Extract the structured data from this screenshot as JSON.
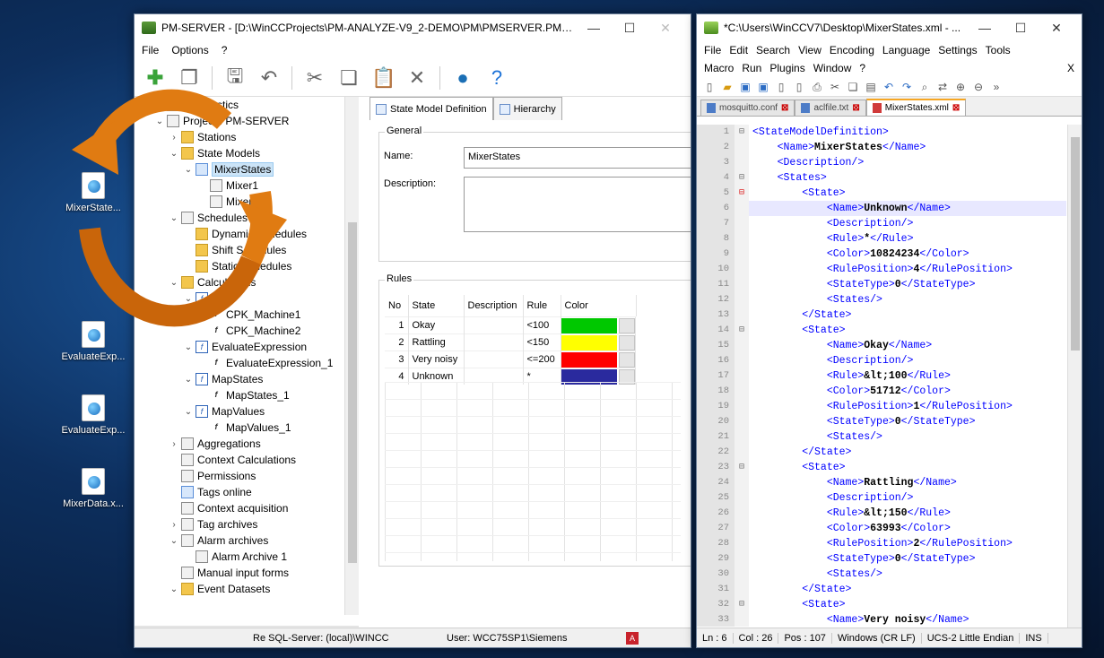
{
  "desktop": {
    "icons": [
      "MixerState...",
      "EvaluateExp...",
      "EvaluateExp...",
      "MixerData.x..."
    ]
  },
  "pm": {
    "title": "PM-SERVER - [D:\\WinCCProjects\\PM-ANALYZE-V9_2-DEMO\\PM\\PMSERVER.PMProj...",
    "minimize": "—",
    "maximize": "☐",
    "close": "✕",
    "menu": [
      "File",
      "Options",
      "?"
    ],
    "tree": [
      "Diagnostics",
      "Project : PM-SERVER",
      "Stations",
      "State Models",
      "MixerStates",
      "Mixer1",
      "Mixer2",
      "Schedules",
      "Dynamic Schedules",
      "Shift Schedules",
      "Static Schedules",
      "Calculations",
      "CPK",
      "CPK_Machine1",
      "CPK_Machine2",
      "EvaluateExpression",
      "EvaluateExpression_1",
      "MapStates",
      "MapStates_1",
      "MapValues",
      "MapValues_1",
      "Aggregations",
      "Context Calculations",
      "Permissions",
      "Tags online",
      "Context acquisition",
      "Tag archives",
      "Alarm archives",
      "Alarm Archive 1",
      "Manual input forms",
      "Event Datasets"
    ],
    "tabs": [
      "State Model Definition",
      "Hierarchy"
    ],
    "general_label": "General",
    "name_label": "Name:",
    "name_value": "MixerStates",
    "description_label": "Description:",
    "rules_label": "Rules",
    "rules_headers": [
      "No",
      "State",
      "Description",
      "Rule",
      "Color"
    ],
    "rules": [
      {
        "no": "1",
        "state": "Okay",
        "desc": "",
        "rule": "<100",
        "color": "#00c800"
      },
      {
        "no": "2",
        "state": "Rattling",
        "desc": "",
        "rule": "<150",
        "color": "#ffff00"
      },
      {
        "no": "3",
        "state": "Very noisy",
        "desc": "",
        "rule": "<=200",
        "color": "#ff0000"
      },
      {
        "no": "4",
        "state": "Unknown",
        "desc": "",
        "rule": "*",
        "color": "#2a2a9e"
      }
    ],
    "status_left": "Re SQL-Server: (local)\\WINCC",
    "status_user": "User: WCC75SP1\\Siemens"
  },
  "np": {
    "title": "*C:\\Users\\WinCCV7\\Desktop\\MixerStates.xml - ...",
    "menu1": [
      "File",
      "Edit",
      "Search",
      "View",
      "Encoding",
      "Language",
      "Settings",
      "Tools"
    ],
    "menu2": [
      "Macro",
      "Run",
      "Plugins",
      "Window",
      "?"
    ],
    "menu_close": "X",
    "tabs": [
      "mosquitto.conf",
      "aclfile.txt",
      "MixerStates.xml"
    ],
    "lines": [
      {
        "n": "1",
        "f": "⊟",
        "ind": "",
        "pre": "<StateModelDefinition>",
        "val": "",
        "post": ""
      },
      {
        "n": "2",
        "f": "",
        "ind": "    ",
        "pre": "<Name>",
        "val": "MixerStates",
        "post": "</Name>"
      },
      {
        "n": "3",
        "f": "",
        "ind": "    ",
        "pre": "<Description/>",
        "val": "",
        "post": ""
      },
      {
        "n": "4",
        "f": "⊟",
        "ind": "    ",
        "pre": "<States>",
        "val": "",
        "post": ""
      },
      {
        "n": "5",
        "f": "⊟",
        "ind": "        ",
        "pre": "<State>",
        "val": "",
        "post": ""
      },
      {
        "n": "6",
        "f": "",
        "ind": "            ",
        "pre": "<Name>",
        "val": "Unknown",
        "post": "</Name>"
      },
      {
        "n": "7",
        "f": "",
        "ind": "            ",
        "pre": "<Description/>",
        "val": "",
        "post": ""
      },
      {
        "n": "8",
        "f": "",
        "ind": "            ",
        "pre": "<Rule>",
        "val": "*",
        "post": "</Rule>"
      },
      {
        "n": "9",
        "f": "",
        "ind": "            ",
        "pre": "<Color>",
        "val": "10824234",
        "post": "</Color>"
      },
      {
        "n": "10",
        "f": "",
        "ind": "            ",
        "pre": "<RulePosition>",
        "val": "4",
        "post": "</RulePosition>"
      },
      {
        "n": "11",
        "f": "",
        "ind": "            ",
        "pre": "<StateType>",
        "val": "0",
        "post": "</StateType>"
      },
      {
        "n": "12",
        "f": "",
        "ind": "            ",
        "pre": "<States/>",
        "val": "",
        "post": ""
      },
      {
        "n": "13",
        "f": "",
        "ind": "        ",
        "pre": "</State>",
        "val": "",
        "post": ""
      },
      {
        "n": "14",
        "f": "⊟",
        "ind": "        ",
        "pre": "<State>",
        "val": "",
        "post": ""
      },
      {
        "n": "15",
        "f": "",
        "ind": "            ",
        "pre": "<Name>",
        "val": "Okay",
        "post": "</Name>"
      },
      {
        "n": "16",
        "f": "",
        "ind": "            ",
        "pre": "<Description/>",
        "val": "",
        "post": ""
      },
      {
        "n": "17",
        "f": "",
        "ind": "            ",
        "pre": "<Rule>",
        "val": "&lt;100",
        "post": "</Rule>"
      },
      {
        "n": "18",
        "f": "",
        "ind": "            ",
        "pre": "<Color>",
        "val": "51712",
        "post": "</Color>"
      },
      {
        "n": "19",
        "f": "",
        "ind": "            ",
        "pre": "<RulePosition>",
        "val": "1",
        "post": "</RulePosition>"
      },
      {
        "n": "20",
        "f": "",
        "ind": "            ",
        "pre": "<StateType>",
        "val": "0",
        "post": "</StateType>"
      },
      {
        "n": "21",
        "f": "",
        "ind": "            ",
        "pre": "<States/>",
        "val": "",
        "post": ""
      },
      {
        "n": "22",
        "f": "",
        "ind": "        ",
        "pre": "</State>",
        "val": "",
        "post": ""
      },
      {
        "n": "23",
        "f": "⊟",
        "ind": "        ",
        "pre": "<State>",
        "val": "",
        "post": ""
      },
      {
        "n": "24",
        "f": "",
        "ind": "            ",
        "pre": "<Name>",
        "val": "Rattling",
        "post": "</Name>"
      },
      {
        "n": "25",
        "f": "",
        "ind": "            ",
        "pre": "<Description/>",
        "val": "",
        "post": ""
      },
      {
        "n": "26",
        "f": "",
        "ind": "            ",
        "pre": "<Rule>",
        "val": "&lt;150",
        "post": "</Rule>"
      },
      {
        "n": "27",
        "f": "",
        "ind": "            ",
        "pre": "<Color>",
        "val": "63993",
        "post": "</Color>"
      },
      {
        "n": "28",
        "f": "",
        "ind": "            ",
        "pre": "<RulePosition>",
        "val": "2",
        "post": "</RulePosition>"
      },
      {
        "n": "29",
        "f": "",
        "ind": "            ",
        "pre": "<StateType>",
        "val": "0",
        "post": "</StateType>"
      },
      {
        "n": "30",
        "f": "",
        "ind": "            ",
        "pre": "<States/>",
        "val": "",
        "post": ""
      },
      {
        "n": "31",
        "f": "",
        "ind": "        ",
        "pre": "</State>",
        "val": "",
        "post": ""
      },
      {
        "n": "32",
        "f": "⊟",
        "ind": "        ",
        "pre": "<State>",
        "val": "",
        "post": ""
      },
      {
        "n": "33",
        "f": "",
        "ind": "            ",
        "pre": "<Name>",
        "val": "Very noisy",
        "post": "</Name>"
      }
    ],
    "current_line": "6",
    "status": [
      "Ln : 6",
      "Col : 26",
      "Pos : 107",
      "Windows (CR LF)",
      "UCS-2 Little Endian",
      "INS"
    ]
  },
  "colors": {
    "arrow": "#e07b12",
    "selection": "#cce4f7",
    "xml_tag": "#0000ff"
  }
}
